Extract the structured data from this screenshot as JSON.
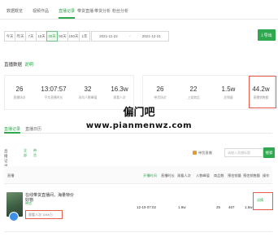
{
  "top_tabs": [
    "数据概览",
    "视频作品",
    "直播记录",
    "带货直播",
    "带货分析",
    "粉丝分析"
  ],
  "range_buttons": [
    "今天",
    "昨天",
    "7天",
    "15天",
    "30天",
    "90天",
    "180天",
    "1年"
  ],
  "active_range_index": 4,
  "date_range": {
    "start": "2021-11-22",
    "separator": "-",
    "end": "2021-12-21"
  },
  "export_label": "导出",
  "section": {
    "title": "直播数据",
    "link": "说明"
  },
  "stats_left": [
    {
      "value": "26",
      "label": "直播场次"
    },
    {
      "value": "13:07:57",
      "label": "平均直播时长"
    },
    {
      "value": "32",
      "label": "场均人数峰值"
    },
    {
      "value": "16.3w",
      "label": "观看人次"
    }
  ],
  "stats_right": [
    {
      "value": "26",
      "label": "带货场次"
    },
    {
      "value": "22",
      "label": "上架商品"
    },
    {
      "value": "1.5w",
      "label": "总销量"
    },
    {
      "value": "44.2w",
      "label": "直播销售额"
    }
  ],
  "sub_tabs": [
    "直播记录",
    "直播日历"
  ],
  "filter": {
    "label": "直播记录",
    "chips": [
      "全部",
      "带货"
    ],
    "checkbox_label": "带货直播",
    "search_placeholder": "请输入直播标题",
    "search_button": "搜索"
  },
  "table_headers": [
    "直播",
    "开播时间",
    "直播时长",
    "观看人次",
    "人数峰值",
    "商品数",
    "预估销量",
    "预估销售额",
    "操作"
  ],
  "row": {
    "title": "在线带货直播间，海量特价好物",
    "tag": "带货",
    "sub_text": "观看人次 1069万",
    "start_time": "12-19 07:02",
    "duration": "",
    "viewers": "1.9w",
    "peak": "",
    "items": "25",
    "sales": "467",
    "revenue": "1.5w",
    "op_link": "详情"
  },
  "watermark": {
    "cn": "偏门吧",
    "url": "www.pianmenwz.com"
  }
}
